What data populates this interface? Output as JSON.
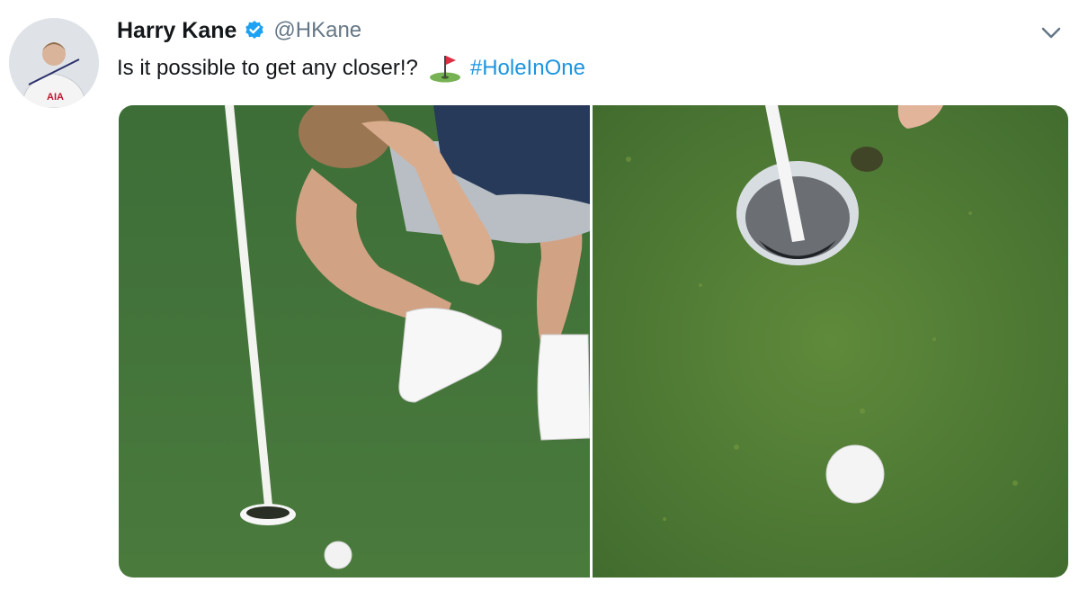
{
  "tweet": {
    "author_name": "Harry Kane",
    "handle": "@HKane",
    "text_main": "Is it possible to get any closer!?",
    "hashtag": "#HoleInOne",
    "avatar_shirt_text": "AIA"
  },
  "icons": {
    "verified": "verified-badge-icon",
    "menu": "chevron-down-icon",
    "emoji": "golf-flag-emoji"
  },
  "colors": {
    "text": "#14171a",
    "secondary": "#657786",
    "link": "#1b95e0",
    "verified": "#1da1f2"
  },
  "media": {
    "photos": [
      "golfer-crouching-near-hole",
      "ball-near-hole-closeup"
    ]
  }
}
